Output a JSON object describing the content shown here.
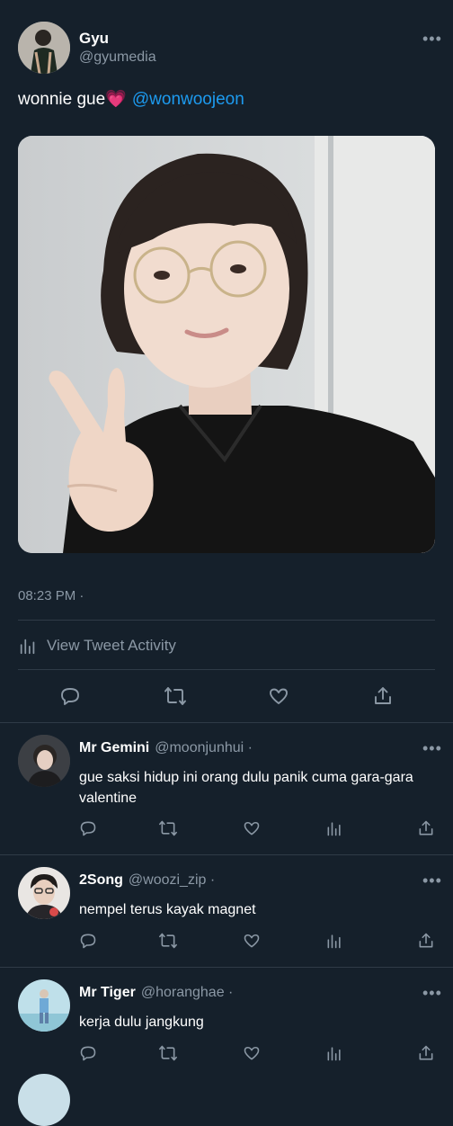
{
  "tweet": {
    "display_name": "Gyu",
    "handle": "@gyumedia",
    "text": "wonnie gue",
    "emoji": "💗",
    "mention": "@wonwoojeon",
    "time": "08:23 PM ·",
    "activity_label": "View Tweet Activity"
  },
  "replies": [
    {
      "name": "Mr Gemini",
      "handle": "@moonjunhui ·",
      "text": "gue saksi hidup ini orang dulu panik cuma gara-gara valentine"
    },
    {
      "name": "2Song",
      "handle": "@woozi_zip ·",
      "text": "nempel terus kayak magnet"
    },
    {
      "name": "Mr Tiger",
      "handle": "@horanghae ·",
      "text": "kerja dulu jangkung"
    }
  ],
  "icons": {
    "reply": "reply-icon",
    "retweet": "retweet-icon",
    "like": "heart-icon",
    "share": "share-icon",
    "analytics": "analytics-icon",
    "more": "more-icon"
  },
  "colors": {
    "background": "#15202b",
    "accent": "#1d9bf0",
    "muted": "#8b98a5",
    "divider": "#2f3b47"
  }
}
